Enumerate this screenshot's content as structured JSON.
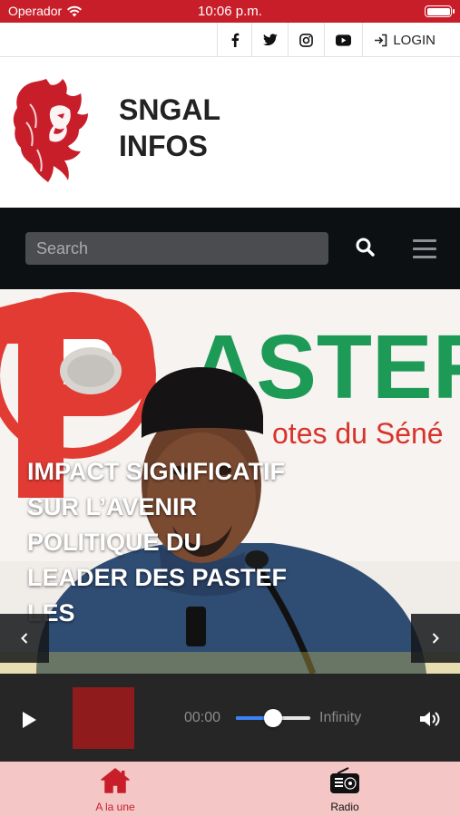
{
  "status_bar": {
    "carrier": "Operador",
    "time": "10:06 p.m.",
    "wifi_icon": "wifi-icon",
    "battery_icon": "battery-icon"
  },
  "social": {
    "facebook_icon": "facebook-icon",
    "twitter_icon": "twitter-icon",
    "instagram_icon": "instagram-icon",
    "youtube_icon": "youtube-icon",
    "login_label": "LOGIN"
  },
  "brand": {
    "name": "SNGAL\nINFOS",
    "logo_icon": "lion-logo"
  },
  "nav": {
    "search_placeholder": "Search",
    "search_icon": "search-icon",
    "menu_icon": "hamburger-menu-icon"
  },
  "hero": {
    "headline": "IMPACT SIGNIFICATIF SUR L’AVENIR POLITIQUE DU LEADER DES PASTEF LES",
    "prev_icon": "chevron-left-icon",
    "next_icon": "chevron-right-icon"
  },
  "player": {
    "current_time": "00:00",
    "duration": "Infinity",
    "volume_level": 0.5,
    "play_icon": "play-icon",
    "volume_icon": "volume-icon",
    "art_color": "#8f1b1d"
  },
  "tabs": [
    {
      "label": "A la une",
      "icon": "home-icon",
      "active": true
    },
    {
      "label": "Radio",
      "icon": "radio-icon",
      "active": false
    }
  ],
  "colors": {
    "brand_red": "#c81e2a",
    "nav_dark": "#0d1013",
    "player_bg": "#262626",
    "tabbar_bg": "#f4c7c6",
    "slider_accent": "#3b82f6"
  }
}
